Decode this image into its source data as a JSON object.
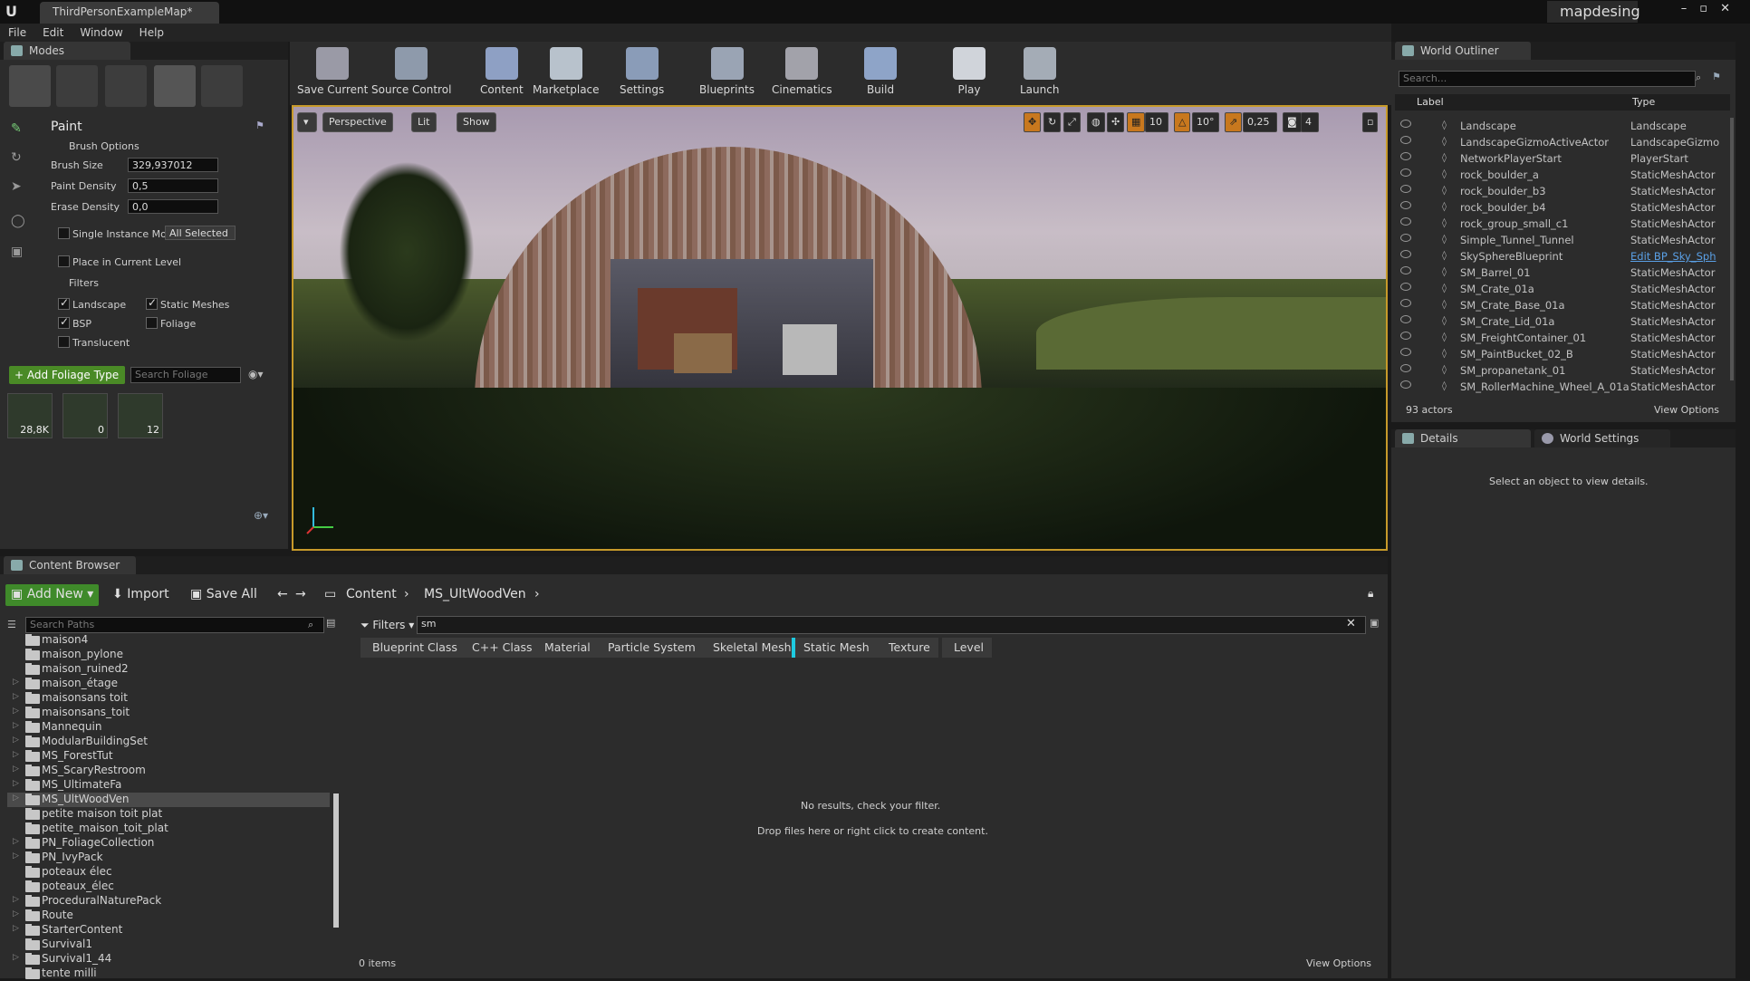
{
  "title_bar": {
    "tab": "ThirdPersonExampleMap*",
    "project": "mapdesing"
  },
  "menu": [
    "File",
    "Edit",
    "Window",
    "Help"
  ],
  "modes": {
    "tab": "Modes",
    "section": "Paint",
    "brush_options": "Brush Options",
    "brush_size_label": "Brush Size",
    "brush_size": "329,937012",
    "paint_density_label": "Paint Density",
    "paint_density": "0,5",
    "erase_density_label": "Erase Density",
    "erase_density": "0,0",
    "single_instance": "Single Instance Mod",
    "single_instance_dropdown": "All Selected",
    "place_in_level": "Place in Current Level",
    "filters": "Filters",
    "filter_landscape": "Landscape",
    "filter_static": "Static Meshes",
    "filter_bsp": "BSP",
    "filter_foliage": "Foliage",
    "filter_translucent": "Translucent",
    "add_foliage": "+ Add Foliage Type",
    "search_foliage_placeholder": "Search Foliage",
    "foliage_counts": [
      "28,8K",
      "0",
      "12"
    ]
  },
  "toolbar": [
    {
      "label": "Save Current",
      "icon": "save-icon",
      "color": "#9a9aa6"
    },
    {
      "label": "Source Control",
      "icon": "source-control-icon",
      "color": "#8e9aab"
    },
    {
      "label": "Content",
      "icon": "content-icon",
      "color": "#8ea0c4"
    },
    {
      "label": "Marketplace",
      "icon": "marketplace-icon",
      "color": "#b8c2cc"
    },
    {
      "label": "Settings",
      "icon": "settings-icon",
      "color": "#8a9cb8"
    },
    {
      "label": "Blueprints",
      "icon": "blueprints-icon",
      "color": "#9aa4b4"
    },
    {
      "label": "Cinematics",
      "icon": "cinematics-icon",
      "color": "#a2a2aa"
    },
    {
      "label": "Build",
      "icon": "build-icon",
      "color": "#8ea4c8"
    },
    {
      "label": "Play",
      "icon": "play-icon",
      "color": "#d0d4da"
    },
    {
      "label": "Launch",
      "icon": "launch-icon",
      "color": "#a4acb6"
    }
  ],
  "viewport": {
    "perspective": "Perspective",
    "lit": "Lit",
    "show": "Show",
    "grid_snap": "10",
    "rot_snap": "10°",
    "scale_snap": "0,25",
    "cam_speed": "4"
  },
  "outliner": {
    "tab": "World Outliner",
    "search_placeholder": "Search...",
    "col_label": "Label",
    "col_type": "Type",
    "rows": [
      {
        "label": "Landscape",
        "type": "Landscape"
      },
      {
        "label": "LandscapeGizmoActiveActor",
        "type": "LandscapeGizmo"
      },
      {
        "label": "NetworkPlayerStart",
        "type": "PlayerStart"
      },
      {
        "label": "rock_boulder_a",
        "type": "StaticMeshActor"
      },
      {
        "label": "rock_boulder_b3",
        "type": "StaticMeshActor"
      },
      {
        "label": "rock_boulder_b4",
        "type": "StaticMeshActor"
      },
      {
        "label": "rock_group_small_c1",
        "type": "StaticMeshActor"
      },
      {
        "label": "Simple_Tunnel_Tunnel",
        "type": "StaticMeshActor"
      },
      {
        "label": "SkySphereBlueprint",
        "type": "Edit BP_Sky_Sph"
      },
      {
        "label": "SM_Barrel_01",
        "type": "StaticMeshActor"
      },
      {
        "label": "SM_Crate_01a",
        "type": "StaticMeshActor"
      },
      {
        "label": "SM_Crate_Base_01a",
        "type": "StaticMeshActor"
      },
      {
        "label": "SM_Crate_Lid_01a",
        "type": "StaticMeshActor"
      },
      {
        "label": "SM_FreightContainer_01",
        "type": "StaticMeshActor"
      },
      {
        "label": "SM_PaintBucket_02_B",
        "type": "StaticMeshActor"
      },
      {
        "label": "SM_propanetank_01",
        "type": "StaticMeshActor"
      },
      {
        "label": "SM_RollerMachine_Wheel_A_01a",
        "type": "StaticMeshActor"
      }
    ],
    "count": "93 actors",
    "view_options": "View Options"
  },
  "details": {
    "tab_details": "Details",
    "tab_world": "World Settings",
    "empty": "Select an object to view details."
  },
  "content_browser": {
    "tab": "Content Browser",
    "add_new": "Add New",
    "import": "Import",
    "save_all": "Save All",
    "path_root": "Content",
    "path_current": "MS_UltWoodVen",
    "search_paths_placeholder": "Search Paths",
    "filters": "Filters",
    "search_value": "sm",
    "chips": [
      "Blueprint Class",
      "C++ Class",
      "Material",
      "Particle System",
      "Skeletal Mesh",
      "Static Mesh",
      "Texture",
      "Level"
    ],
    "folders": [
      {
        "name": "maison4",
        "arrow": false
      },
      {
        "name": "maison_pylone",
        "arrow": false
      },
      {
        "name": "maison_ruined2",
        "arrow": false
      },
      {
        "name": "maison_étage",
        "arrow": true
      },
      {
        "name": "maisonsans toit",
        "arrow": true
      },
      {
        "name": "maisonsans_toit",
        "arrow": true
      },
      {
        "name": "Mannequin",
        "arrow": true
      },
      {
        "name": "ModularBuildingSet",
        "arrow": true
      },
      {
        "name": "MS_ForestTut",
        "arrow": true
      },
      {
        "name": "MS_ScaryRestroom",
        "arrow": true
      },
      {
        "name": "MS_UltimateFa",
        "arrow": true
      },
      {
        "name": "MS_UltWoodVen",
        "arrow": true
      },
      {
        "name": "petite maison toit plat",
        "arrow": false
      },
      {
        "name": "petite_maison_toit_plat",
        "arrow": false
      },
      {
        "name": "PN_FoliageCollection",
        "arrow": true
      },
      {
        "name": "PN_IvyPack",
        "arrow": true
      },
      {
        "name": "poteaux élec",
        "arrow": false
      },
      {
        "name": "poteaux_élec",
        "arrow": false
      },
      {
        "name": "ProceduralNaturePack",
        "arrow": true
      },
      {
        "name": "Route",
        "arrow": true
      },
      {
        "name": "StarterContent",
        "arrow": true
      },
      {
        "name": "Survival1",
        "arrow": false
      },
      {
        "name": "Survival1_44",
        "arrow": true
      },
      {
        "name": "tente milli",
        "arrow": false
      }
    ],
    "no_results": "No results, check your filter.",
    "drop_hint": "Drop files here or right click to create content.",
    "items_count": "0 items",
    "view_options": "View Options"
  }
}
